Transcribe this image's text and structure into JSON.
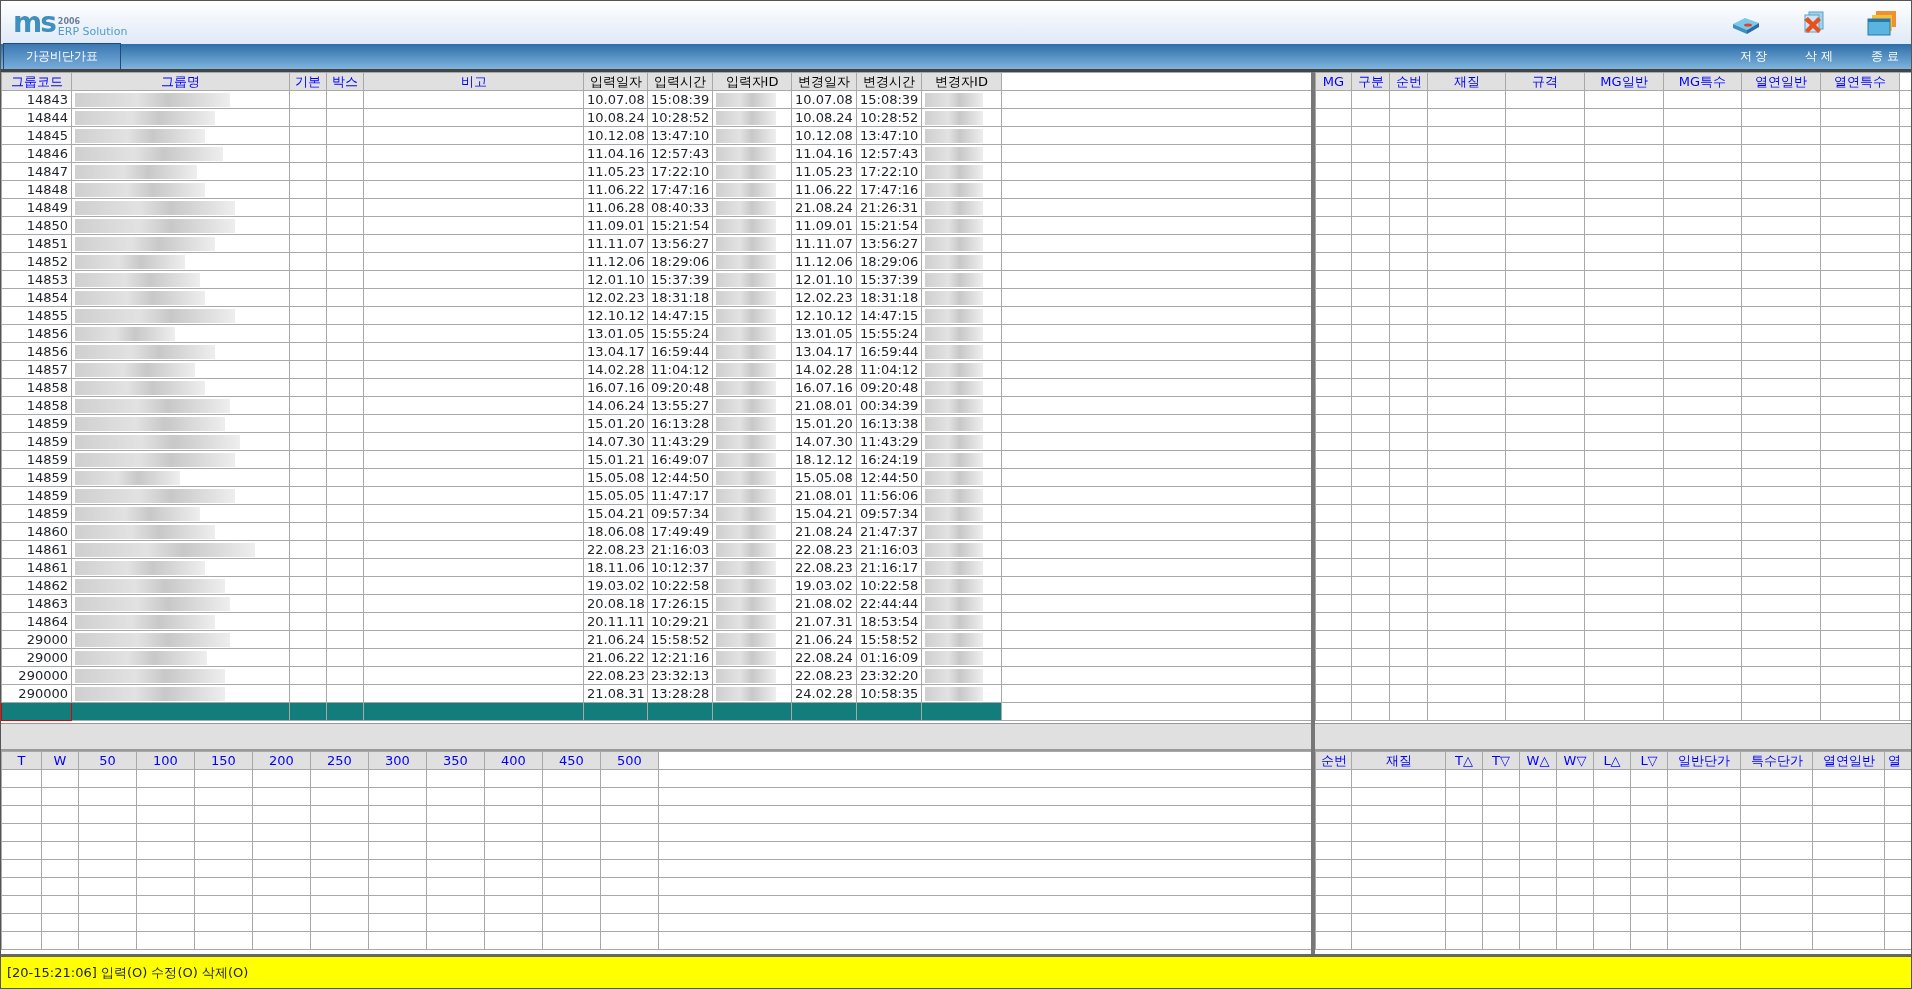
{
  "logo": {
    "mark": "ms",
    "year": "2006",
    "product": "ERP Solution"
  },
  "tab": {
    "label": "가공비단가표",
    "selected": true
  },
  "toolbar": [
    {
      "kind": "save",
      "label": "저 장"
    },
    {
      "kind": "delete",
      "label": "삭 제"
    },
    {
      "kind": "exit",
      "label": "종 료"
    }
  ],
  "main_table": {
    "columns": [
      {
        "label": "그룹코드",
        "editable": true
      },
      {
        "label": "그룹명",
        "editable": true
      },
      {
        "label": "기본",
        "editable": true
      },
      {
        "label": "박스",
        "editable": true
      },
      {
        "label": "비고",
        "editable": true
      },
      {
        "label": "입력일자",
        "editable": false
      },
      {
        "label": "입력시간",
        "editable": false
      },
      {
        "label": "입력자ID",
        "editable": false
      },
      {
        "label": "변경일자",
        "editable": false
      },
      {
        "label": "변경시간",
        "editable": false
      },
      {
        "label": "변경자ID",
        "editable": false
      }
    ],
    "rows": [
      {
        "code": "14843",
        "redacted": true,
        "in_date": "10.07.08",
        "in_time": "15:08:39",
        "mod_date": "10.07.08",
        "mod_time": "15:08:39",
        "selected": false
      },
      {
        "code": "14844",
        "redacted": true,
        "in_date": "10.08.24",
        "in_time": "10:28:52",
        "mod_date": "10.08.24",
        "mod_time": "10:28:52",
        "selected": false
      },
      {
        "code": "14845",
        "redacted": true,
        "in_date": "10.12.08",
        "in_time": "13:47:10",
        "mod_date": "10.12.08",
        "mod_time": "13:47:10",
        "selected": false
      },
      {
        "code": "14846",
        "redacted": true,
        "in_date": "11.04.16",
        "in_time": "12:57:43",
        "mod_date": "11.04.16",
        "mod_time": "12:57:43",
        "selected": false
      },
      {
        "code": "14847",
        "redacted": true,
        "in_date": "11.05.23",
        "in_time": "17:22:10",
        "mod_date": "11.05.23",
        "mod_time": "17:22:10",
        "selected": false
      },
      {
        "code": "14848",
        "redacted": true,
        "in_date": "11.06.22",
        "in_time": "17:47:16",
        "mod_date": "11.06.22",
        "mod_time": "17:47:16",
        "selected": false
      },
      {
        "code": "14849",
        "redacted": true,
        "in_date": "11.06.28",
        "in_time": "08:40:33",
        "mod_date": "21.08.24",
        "mod_time": "21:26:31",
        "selected": false
      },
      {
        "code": "14850",
        "redacted": true,
        "in_date": "11.09.01",
        "in_time": "15:21:54",
        "mod_date": "11.09.01",
        "mod_time": "15:21:54",
        "selected": false
      },
      {
        "code": "14851",
        "redacted": true,
        "in_date": "11.11.07",
        "in_time": "13:56:27",
        "mod_date": "11.11.07",
        "mod_time": "13:56:27",
        "selected": false
      },
      {
        "code": "14852",
        "redacted": true,
        "in_date": "11.12.06",
        "in_time": "18:29:06",
        "mod_date": "11.12.06",
        "mod_time": "18:29:06",
        "selected": false
      },
      {
        "code": "14853",
        "redacted": true,
        "in_date": "12.01.10",
        "in_time": "15:37:39",
        "mod_date": "12.01.10",
        "mod_time": "15:37:39",
        "selected": false
      },
      {
        "code": "14854",
        "redacted": true,
        "in_date": "12.02.23",
        "in_time": "18:31:18",
        "mod_date": "12.02.23",
        "mod_time": "18:31:18",
        "selected": false
      },
      {
        "code": "14855",
        "redacted": true,
        "in_date": "12.10.12",
        "in_time": "14:47:15",
        "mod_date": "12.10.12",
        "mod_time": "14:47:15",
        "selected": false
      },
      {
        "code": "14856",
        "redacted": true,
        "in_date": "13.01.05",
        "in_time": "15:55:24",
        "mod_date": "13.01.05",
        "mod_time": "15:55:24",
        "selected": false
      },
      {
        "code": "14856",
        "redacted": true,
        "in_date": "13.04.17",
        "in_time": "16:59:44",
        "mod_date": "13.04.17",
        "mod_time": "16:59:44",
        "selected": false
      },
      {
        "code": "14857",
        "redacted": true,
        "in_date": "14.02.28",
        "in_time": "11:04:12",
        "mod_date": "14.02.28",
        "mod_time": "11:04:12",
        "selected": false
      },
      {
        "code": "14858",
        "redacted": true,
        "in_date": "16.07.16",
        "in_time": "09:20:48",
        "mod_date": "16.07.16",
        "mod_time": "09:20:48",
        "selected": false
      },
      {
        "code": "14858",
        "redacted": true,
        "in_date": "14.06.24",
        "in_time": "13:55:27",
        "mod_date": "21.08.01",
        "mod_time": "00:34:39",
        "selected": false
      },
      {
        "code": "14859",
        "redacted": true,
        "in_date": "15.01.20",
        "in_time": "16:13:28",
        "mod_date": "15.01.20",
        "mod_time": "16:13:38",
        "selected": false
      },
      {
        "code": "14859",
        "redacted": true,
        "in_date": "14.07.30",
        "in_time": "11:43:29",
        "mod_date": "14.07.30",
        "mod_time": "11:43:29",
        "selected": false
      },
      {
        "code": "14859",
        "redacted": true,
        "in_date": "15.01.21",
        "in_time": "16:49:07",
        "mod_date": "18.12.12",
        "mod_time": "16:24:19",
        "selected": false
      },
      {
        "code": "14859",
        "redacted": true,
        "in_date": "15.05.08",
        "in_time": "12:44:50",
        "mod_date": "15.05.08",
        "mod_time": "12:44:50",
        "selected": false
      },
      {
        "code": "14859",
        "redacted": true,
        "in_date": "15.05.05",
        "in_time": "11:47:17",
        "mod_date": "21.08.01",
        "mod_time": "11:56:06",
        "selected": false
      },
      {
        "code": "14859",
        "redacted": true,
        "in_date": "15.04.21",
        "in_time": "09:57:34",
        "mod_date": "15.04.21",
        "mod_time": "09:57:34",
        "selected": false
      },
      {
        "code": "14860",
        "redacted": true,
        "in_date": "18.06.08",
        "in_time": "17:49:49",
        "mod_date": "21.08.24",
        "mod_time": "21:47:37",
        "selected": false
      },
      {
        "code": "14861",
        "redacted": true,
        "in_date": "22.08.23",
        "in_time": "21:16:03",
        "mod_date": "22.08.23",
        "mod_time": "21:16:03",
        "selected": false
      },
      {
        "code": "14861",
        "redacted": true,
        "in_date": "18.11.06",
        "in_time": "10:12:37",
        "mod_date": "22.08.23",
        "mod_time": "21:16:17",
        "selected": false
      },
      {
        "code": "14862",
        "redacted": true,
        "in_date": "19.03.02",
        "in_time": "10:22:58",
        "mod_date": "19.03.02",
        "mod_time": "10:22:58",
        "selected": false
      },
      {
        "code": "14863",
        "redacted": true,
        "in_date": "20.08.18",
        "in_time": "17:26:15",
        "mod_date": "21.08.02",
        "mod_time": "22:44:44",
        "selected": false
      },
      {
        "code": "14864",
        "redacted": true,
        "in_date": "20.11.11",
        "in_time": "10:29:21",
        "mod_date": "21.07.31",
        "mod_time": "18:53:54",
        "selected": false
      },
      {
        "code": "29000",
        "redacted": true,
        "in_date": "21.06.24",
        "in_time": "15:58:52",
        "mod_date": "21.06.24",
        "mod_time": "15:58:52",
        "selected": false
      },
      {
        "code": "29000",
        "redacted": true,
        "in_date": "21.06.22",
        "in_time": "12:21:16",
        "mod_date": "22.08.24",
        "mod_time": "01:16:09",
        "selected": false
      },
      {
        "code": "290000",
        "redacted": true,
        "in_date": "22.08.23",
        "in_time": "23:32:13",
        "mod_date": "22.08.23",
        "mod_time": "23:32:20",
        "selected": false
      },
      {
        "code": "290000",
        "redacted": true,
        "in_date": "21.08.31",
        "in_time": "13:28:28",
        "mod_date": "24.02.28",
        "mod_time": "10:58:35",
        "selected": false
      }
    ],
    "new_row": {
      "selected": true
    }
  },
  "mg_table": {
    "columns": [
      "MG",
      "구분",
      "순번",
      "재질",
      "규격",
      "MG일반",
      "MG특수",
      "열연일반",
      "열연특수"
    ]
  },
  "size_table": {
    "columns": [
      "T",
      "W",
      "50",
      "100",
      "150",
      "200",
      "250",
      "300",
      "350",
      "400",
      "450",
      "500"
    ]
  },
  "price_table": {
    "columns": [
      "순번",
      "재질",
      "T△",
      "T▽",
      "W△",
      "W▽",
      "L△",
      "L▽",
      "일반단가",
      "특수단가",
      "열연일반",
      "열"
    ]
  },
  "status_bar": {
    "message": "[20-15:21:06] 입력(O) 수정(O) 삭제(O)"
  }
}
